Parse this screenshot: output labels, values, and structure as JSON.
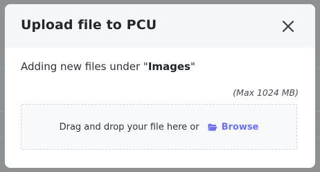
{
  "dialog": {
    "title": "Upload file to PCU",
    "close_icon": "close-icon",
    "subtitle_prefix": "Adding new files under \"",
    "folder_name": "Images",
    "subtitle_suffix": "\"",
    "max_size": "(Max 1024 MB)",
    "dropzone": {
      "text": "Drag and drop your file here or",
      "browse_label": "Browse",
      "browse_icon": "folder-open-icon"
    }
  },
  "colors": {
    "backdrop": "#8f9092",
    "header_bg": "#f5f6f8",
    "accent": "#6c6ff5",
    "title_text": "#23262b"
  }
}
